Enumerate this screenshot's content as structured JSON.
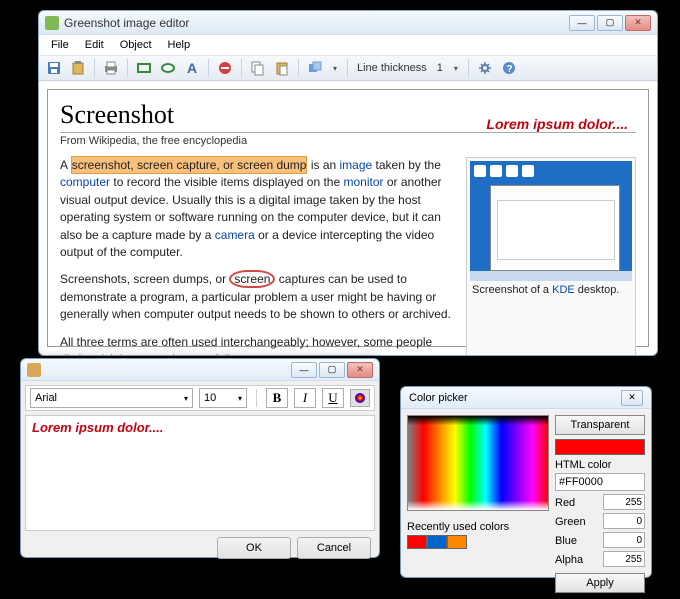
{
  "main": {
    "title": "Greenshot image editor",
    "menu": {
      "file": "File",
      "edit": "Edit",
      "object": "Object",
      "help": "Help"
    },
    "toolbar": {
      "line_thickness_label": "Line thickness",
      "line_thickness_value": "1"
    },
    "document": {
      "heading": "Screenshot",
      "from": "From Wikipedia, the free encyclopedia",
      "annotation": "Lorem ipsum dolor....",
      "p1_a": "A ",
      "p1_highlight": "screenshot, screen capture, or screen dump",
      "p1_b": " is an ",
      "p1_link1": "image",
      "p1_c": " taken by the ",
      "p1_link2": "computer",
      "p1_d": " to record the visible items displayed on the ",
      "p1_link3": "monitor",
      "p1_e": " or another visual output device. Usually this is a digital image taken by the host operating system or software running on the computer device, but it can also be a capture made by a ",
      "p1_link4": "camera",
      "p1_f": " or a device intercepting the video output of the computer.",
      "p2_a": "Screenshots, screen dumps, or ",
      "p2_circled": "screen",
      "p2_b": " captures can be used to demonstrate a program, a particular problem a user might be having or generally when computer output needs to be shown to others or archived.",
      "p3": "All three terms are often used interchangeably; however, some people distinguish between them as follows:",
      "figure_caption_a": "Screenshot of a ",
      "figure_caption_link": "KDE",
      "figure_caption_b": " desktop."
    }
  },
  "text_editor": {
    "font": "Arial",
    "size": "10",
    "content": "Lorem ipsum dolor....",
    "ok": "OK",
    "cancel": "Cancel",
    "bold": "B",
    "italic": "I",
    "underline": "U"
  },
  "color_picker": {
    "title": "Color picker",
    "transparent": "Transparent",
    "current_color": "#FF0000",
    "html_label": "HTML color",
    "html_value": "#FF0000",
    "red_label": "Red",
    "red_value": "255",
    "green_label": "Green",
    "green_value": "0",
    "blue_label": "Blue",
    "blue_value": "0",
    "alpha_label": "Alpha",
    "alpha_value": "255",
    "recent_label": "Recently used colors",
    "recent": [
      "#FF0000",
      "#0066CC",
      "#FF8800"
    ],
    "apply": "Apply"
  }
}
